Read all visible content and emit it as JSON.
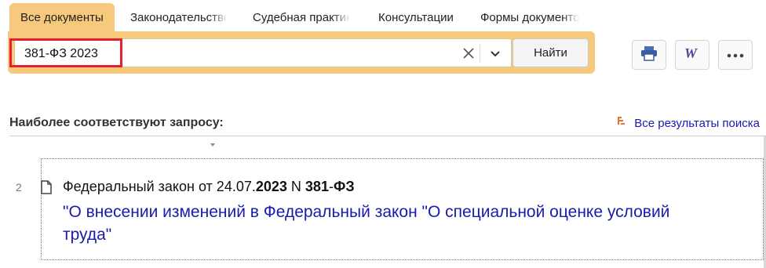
{
  "tabs": [
    {
      "label": "Все документы"
    },
    {
      "label": "Законодательство"
    },
    {
      "label": "Судебная практика"
    },
    {
      "label": "Консультации"
    },
    {
      "label": "Формы документов"
    }
  ],
  "search": {
    "query": "381-ФЗ 2023",
    "find_label": "Найти"
  },
  "toolbar": {
    "print_icon": "printer-icon",
    "word_icon": "word-export-icon",
    "more_icon": "more-icon"
  },
  "results": {
    "heading": "Наиболее соответствуют запросу:",
    "all_results_label": "Все результаты поиска",
    "items": [
      {
        "number": "2",
        "prefix": "Федеральный закон от 24.07.",
        "year": "2023",
        "n_label": " N ",
        "num": "381",
        "dash": "-",
        "fz": "ФЗ",
        "title": "\"О внесении изменений в Федеральный закон \"О специальной оценке условий труда\""
      }
    ]
  },
  "colors": {
    "accent": "#f7c97c",
    "link": "#1a1ab0",
    "highlight": "#e5222b"
  }
}
